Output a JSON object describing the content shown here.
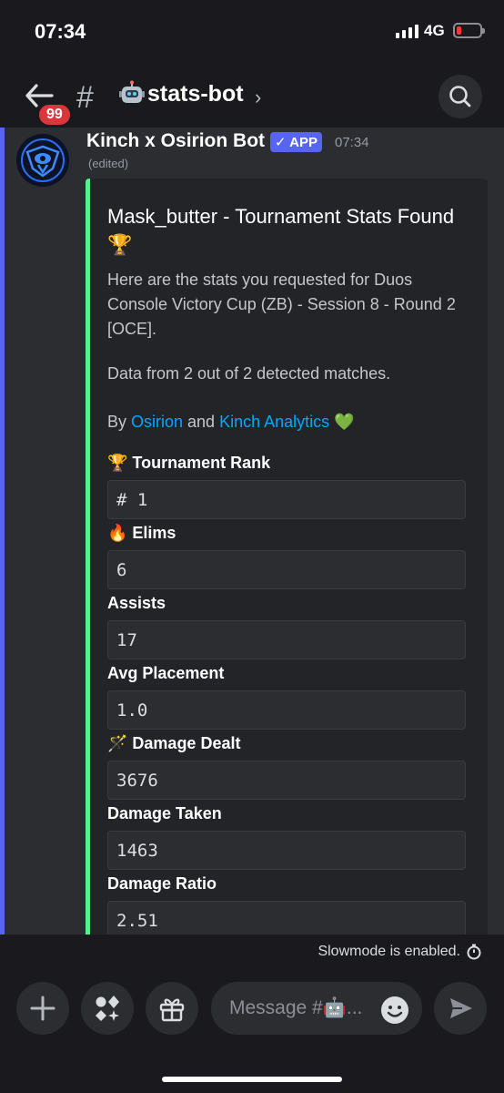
{
  "status": {
    "time": "07:34",
    "network": "4G"
  },
  "header": {
    "unread_badge": "99",
    "hash": "#",
    "channel_emoji": "robot-icon",
    "channel_name": "stats-bot",
    "chevron": "›"
  },
  "message": {
    "author": "Kinch x Osirion Bot",
    "app_tag": "✓ APP",
    "time": "07:34",
    "edited": "(edited)",
    "embed": {
      "accent_color": "#57f287",
      "title": "Mask_butter - Tournament Stats Found 🏆",
      "description": "Here are the stats you requested for Duos Console Victory Cup (ZB) - Session 8 - Round 2 [OCE].",
      "data_line": "Data from 2 out of 2 detected matches.",
      "credit_prefix": "By ",
      "credit_link1": "Osirion",
      "credit_mid": " and ",
      "credit_link2": "Kinch Analytics",
      "credit_emoji": " 💚",
      "fields": [
        {
          "name": "🏆 Tournament Rank",
          "value": "# 1"
        },
        {
          "name": "🔥 Elims",
          "value": "6"
        },
        {
          "name": "Assists",
          "value": "17"
        },
        {
          "name": "Avg Placement",
          "value": "1.0"
        },
        {
          "name": "🪄 Damage Dealt",
          "value": "3676"
        },
        {
          "name": "Damage Taken",
          "value": "1463"
        },
        {
          "name": "Damage Ratio",
          "value": "2.51"
        }
      ]
    }
  },
  "footer": {
    "slowmode": "Slowmode is enabled.",
    "placeholder": "Message #🤖..."
  },
  "colors": {
    "blurple": "#5865f2",
    "link": "#00a8fc",
    "badge_red": "#da373c"
  }
}
